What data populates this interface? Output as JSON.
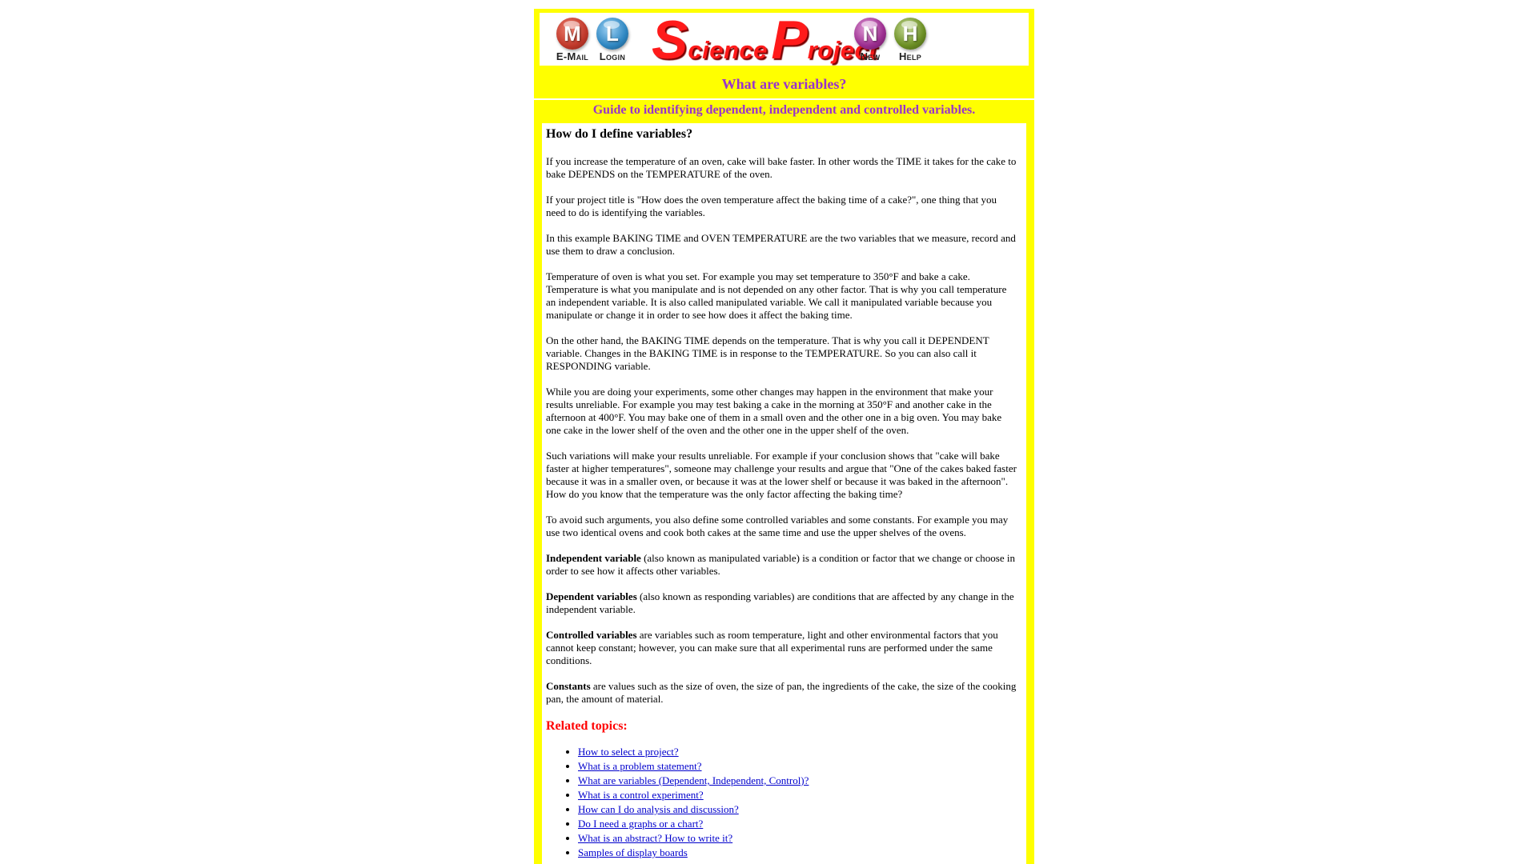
{
  "header": {
    "buttons": [
      {
        "letter": "M",
        "caption": "E-Mail",
        "color": "#c0392b"
      },
      {
        "letter": "L",
        "caption": "Login",
        "color": "#2e86c1"
      },
      {
        "letter": "N",
        "caption": "New",
        "color": "#9b2d8f"
      },
      {
        "letter": "H",
        "caption": "Help",
        "color": "#6b8e23"
      }
    ],
    "logo": {
      "s": "S",
      "cience": "cience",
      "p": "P",
      "roject": "roject"
    }
  },
  "title": "What are variables?",
  "subtitle": "Guide to identifying dependent, independent and controlled variables.",
  "article": {
    "heading": "How do I define variables?",
    "paragraphs": [
      "If you increase the temperature of an oven, cake will bake faster. In other words the TIME it takes for the cake to bake DEPENDS on the TEMPERATURE of the oven.",
      "If your project title is \"How does the oven temperature affect the baking time of a cake?\", one thing that you need to do is identifying the variables.",
      "In this example BAKING TIME and OVEN TEMPERATURE are the two variables that we measure, record and use them to draw a conclusion.",
      "Temperature of oven is what you set. For example you may set temperature to 350°F and bake a cake. Temperature is what you manipulate and is not depended on any other factor. That is why you call temperature an independent variable. It is also called manipulated variable. We call it manipulated variable because you manipulate or change it in order to see how does it affect the baking time.",
      "On the other hand, the BAKING TIME depends on the temperature. That is why you call it DEPENDENT variable. Changes in the BAKING TIME is in response to the TEMPERATURE. So you can also call it RESPONDING variable.",
      "While you are doing your experiments, some other changes may happen in the environment that make your results unreliable. For example you may test baking a cake in the morning at 350°F and another cake in the afternoon at 400°F. You may bake one of them in a small oven and the other one in a big oven. You may bake one cake in the lower shelf of the oven and the other one in the upper shelf of the oven.",
      "Such variations will make your results unreliable. For example if your conclusion shows that \"cake will bake faster at higher temperatures\", someone may challenge your results and argue that \"One of the cakes baked faster because it was in a smaller oven, or because it was at the lower shelf or because it was baked in the afternoon\". How do you know that the temperature was the only factor affecting the baking time?",
      "To avoid such arguments, you also define some controlled variables and some constants. For example you may use two identical ovens and cook both cakes at the same time and use the upper shelves of the ovens."
    ],
    "definitions": [
      {
        "term": "Independent variable",
        "text": " (also known as manipulated variable) is a condition or factor that we change or choose in order to see how it affects other variables."
      },
      {
        "term": "Dependent variables",
        "text": " (also known as responding variables) are conditions that are affected by any change in the independent variable."
      },
      {
        "term": "Controlled variables",
        "text": " are variables such as room temperature, light and other environmental factors that you cannot keep constant; however, you can make sure that all experimental runs are performed under the same conditions."
      },
      {
        "term": "Constants",
        "text": " are values such as the size of oven, the size of pan, the ingredients of the cake, the size of the cooking pan, the amount of material."
      }
    ],
    "related_heading": "Related topics:",
    "related_links": [
      "How to select a project?",
      "What is a problem statement?",
      "What are variables (Dependent, Independent, Control)?",
      "What is a control experiment?",
      "How can I do analysis and discussion?",
      "Do I need a graphs or a chart?",
      "What is an abstract? How to write it?",
      "Samples of display boards"
    ]
  },
  "colors": {
    "page_bg": "#ffff00",
    "title": "#9933cc",
    "related": "#ff0000",
    "link": "#0000cc"
  }
}
